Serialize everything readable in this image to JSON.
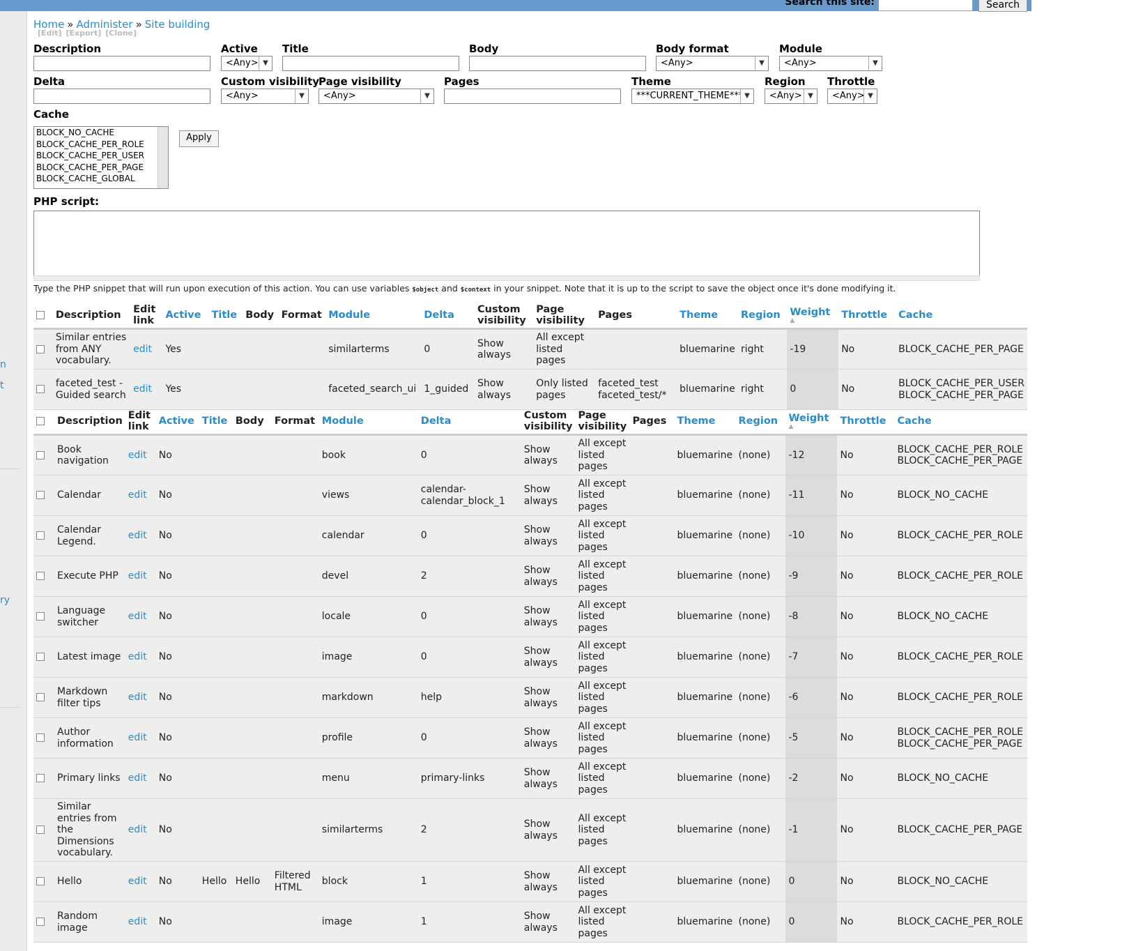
{
  "search": {
    "label": "Search this site:",
    "button": "Search",
    "value": ""
  },
  "breadcrumb": {
    "home": "Home",
    "sep1": "»",
    "administer": "Administer",
    "sep2": "»",
    "site_building": "Site building"
  },
  "tabs": [
    "[Edit]",
    "[Export]",
    "[Clone]"
  ],
  "filters": {
    "description": {
      "label": "Description",
      "value": ""
    },
    "active": {
      "label": "Active",
      "value": "<Any>"
    },
    "title": {
      "label": "Title",
      "value": ""
    },
    "body": {
      "label": "Body",
      "value": ""
    },
    "body_format": {
      "label": "Body format",
      "value": "<Any>"
    },
    "module": {
      "label": "Module",
      "value": "<Any>"
    },
    "delta": {
      "label": "Delta",
      "value": ""
    },
    "custom_visibility": {
      "label": "Custom visibility",
      "value": "<Any>"
    },
    "page_visibility": {
      "label": "Page visibility",
      "value": "<Any>"
    },
    "pages": {
      "label": "Pages",
      "value": ""
    },
    "theme": {
      "label": "Theme",
      "value": "***CURRENT_THEME***"
    },
    "region": {
      "label": "Region",
      "value": "<Any>"
    },
    "throttle": {
      "label": "Throttle",
      "value": "<Any>"
    },
    "cache": {
      "label": "Cache",
      "options": [
        "BLOCK_NO_CACHE",
        "BLOCK_CACHE_PER_ROLE",
        "BLOCK_CACHE_PER_USER",
        "BLOCK_CACHE_PER_PAGE",
        "BLOCK_CACHE_GLOBAL"
      ]
    },
    "apply": "Apply"
  },
  "php": {
    "label": "PHP script:",
    "value": "",
    "hint_pre": "Type the PHP snippet that will run upon execution of this action. You can use variables ",
    "var1": "$object",
    "hint_mid": " and ",
    "var2": "$context",
    "hint_post": " in your snippet. Note that it is up to the script to save the object once it's done modifying it."
  },
  "columns": {
    "description": "Description",
    "edit_link": "Edit link",
    "active": "Active",
    "title": "Title",
    "body": "Body",
    "format": "Format",
    "module": "Module",
    "delta": "Delta",
    "custom_visibility": "Custom visibility",
    "page_visibility": "Page visibility",
    "pages": "Pages",
    "theme": "Theme",
    "region": "Region",
    "weight": "Weight",
    "throttle": "Throttle",
    "cache": "Cache"
  },
  "table1_rows": [
    {
      "description": "Similar entries from ANY vocabulary.",
      "edit": "edit",
      "active": "Yes",
      "title": "",
      "body": "",
      "format": "",
      "module": "similarterms",
      "delta": "0",
      "custom_visibility": "Show always",
      "page_visibility": "All except listed pages",
      "pages": "",
      "theme": "bluemarine",
      "region": "right",
      "weight": "-19",
      "throttle": "No",
      "cache": "BLOCK_CACHE_PER_PAGE"
    },
    {
      "description": "faceted_test - Guided search",
      "edit": "edit",
      "active": "Yes",
      "title": "",
      "body": "",
      "format": "",
      "module": "faceted_search_ui",
      "delta": "1_guided",
      "custom_visibility": "Show always",
      "page_visibility": "Only listed pages",
      "pages": "faceted_test faceted_test/*",
      "theme": "bluemarine",
      "region": "right",
      "weight": "0",
      "throttle": "No",
      "cache": "BLOCK_CACHE_PER_USER BLOCK_CACHE_PER_PAGE"
    }
  ],
  "table2_rows": [
    {
      "description": "Book navigation",
      "edit": "edit",
      "active": "No",
      "title": "",
      "body": "",
      "format": "",
      "module": "book",
      "delta": "0",
      "custom_visibility": "Show always",
      "page_visibility": "All except listed pages",
      "pages": "",
      "theme": "bluemarine",
      "region": "(none)",
      "weight": "-12",
      "throttle": "No",
      "cache": "BLOCK_CACHE_PER_ROLE BLOCK_CACHE_PER_PAGE"
    },
    {
      "description": "Calendar",
      "edit": "edit",
      "active": "No",
      "title": "",
      "body": "",
      "format": "",
      "module": "views",
      "delta": "calendar-calendar_block_1",
      "custom_visibility": "Show always",
      "page_visibility": "All except listed pages",
      "pages": "",
      "theme": "bluemarine",
      "region": "(none)",
      "weight": "-11",
      "throttle": "No",
      "cache": "BLOCK_NO_CACHE"
    },
    {
      "description": "Calendar Legend.",
      "edit": "edit",
      "active": "No",
      "title": "",
      "body": "",
      "format": "",
      "module": "calendar",
      "delta": "0",
      "custom_visibility": "Show always",
      "page_visibility": "All except listed pages",
      "pages": "",
      "theme": "bluemarine",
      "region": "(none)",
      "weight": "-10",
      "throttle": "No",
      "cache": "BLOCK_CACHE_PER_ROLE"
    },
    {
      "description": "Execute PHP",
      "edit": "edit",
      "active": "No",
      "title": "",
      "body": "",
      "format": "",
      "module": "devel",
      "delta": "2",
      "custom_visibility": "Show always",
      "page_visibility": "All except listed pages",
      "pages": "",
      "theme": "bluemarine",
      "region": "(none)",
      "weight": "-9",
      "throttle": "No",
      "cache": "BLOCK_CACHE_PER_ROLE"
    },
    {
      "description": "Language switcher",
      "edit": "edit",
      "active": "No",
      "title": "",
      "body": "",
      "format": "",
      "module": "locale",
      "delta": "0",
      "custom_visibility": "Show always",
      "page_visibility": "All except listed pages",
      "pages": "",
      "theme": "bluemarine",
      "region": "(none)",
      "weight": "-8",
      "throttle": "No",
      "cache": "BLOCK_NO_CACHE"
    },
    {
      "description": "Latest image",
      "edit": "edit",
      "active": "No",
      "title": "",
      "body": "",
      "format": "",
      "module": "image",
      "delta": "0",
      "custom_visibility": "Show always",
      "page_visibility": "All except listed pages",
      "pages": "",
      "theme": "bluemarine",
      "region": "(none)",
      "weight": "-7",
      "throttle": "No",
      "cache": "BLOCK_CACHE_PER_ROLE"
    },
    {
      "description": "Markdown filter tips",
      "edit": "edit",
      "active": "No",
      "title": "",
      "body": "",
      "format": "",
      "module": "markdown",
      "delta": "help",
      "custom_visibility": "Show always",
      "page_visibility": "All except listed pages",
      "pages": "",
      "theme": "bluemarine",
      "region": "(none)",
      "weight": "-6",
      "throttle": "No",
      "cache": "BLOCK_CACHE_PER_ROLE"
    },
    {
      "description": "Author information",
      "edit": "edit",
      "active": "No",
      "title": "",
      "body": "",
      "format": "",
      "module": "profile",
      "delta": "0",
      "custom_visibility": "Show always",
      "page_visibility": "All except listed pages",
      "pages": "",
      "theme": "bluemarine",
      "region": "(none)",
      "weight": "-5",
      "throttle": "No",
      "cache": "BLOCK_CACHE_PER_ROLE BLOCK_CACHE_PER_PAGE"
    },
    {
      "description": "Primary links",
      "edit": "edit",
      "active": "No",
      "title": "",
      "body": "",
      "format": "",
      "module": "menu",
      "delta": "primary-links",
      "custom_visibility": "Show always",
      "page_visibility": "All except listed pages",
      "pages": "",
      "theme": "bluemarine",
      "region": "(none)",
      "weight": "-2",
      "throttle": "No",
      "cache": "BLOCK_NO_CACHE"
    },
    {
      "description": "Similar entries from the Dimensions vocabulary.",
      "edit": "edit",
      "active": "No",
      "title": "",
      "body": "",
      "format": "",
      "module": "similarterms",
      "delta": "2",
      "custom_visibility": "Show always",
      "page_visibility": "All except listed pages",
      "pages": "",
      "theme": "bluemarine",
      "region": "(none)",
      "weight": "-1",
      "throttle": "No",
      "cache": "BLOCK_CACHE_PER_PAGE"
    },
    {
      "description": "Hello",
      "edit": "edit",
      "active": "No",
      "title": "Hello",
      "body": "Hello",
      "format": "Filtered HTML",
      "module": "block",
      "delta": "1",
      "custom_visibility": "Show always",
      "page_visibility": "All except listed pages",
      "pages": "",
      "theme": "bluemarine",
      "region": "(none)",
      "weight": "0",
      "throttle": "No",
      "cache": "BLOCK_NO_CACHE"
    },
    {
      "description": "Random image",
      "edit": "edit",
      "active": "No",
      "title": "",
      "body": "",
      "format": "",
      "module": "image",
      "delta": "1",
      "custom_visibility": "Show always",
      "page_visibility": "All except listed pages",
      "pages": "",
      "theme": "bluemarine",
      "region": "(none)",
      "weight": "0",
      "throttle": "No",
      "cache": "BLOCK_CACHE_PER_ROLE"
    }
  ],
  "sidebar_fragments": [
    "n",
    "t",
    "ry"
  ]
}
